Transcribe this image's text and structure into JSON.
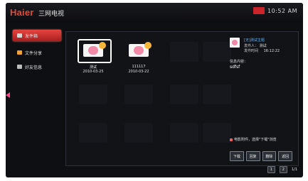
{
  "header": {
    "logo": "Haier",
    "logo_sub": "三网电视",
    "time": "10:52 AM"
  },
  "sidebar": {
    "items": [
      {
        "label": "发件箱",
        "icon": "mail-icon"
      },
      {
        "label": "文件分享",
        "icon": "folder-icon"
      },
      {
        "label": "好友信息",
        "icon": "contacts-icon"
      }
    ]
  },
  "mail_list": [
    {
      "title": "测试",
      "date": "2010-03-25"
    },
    {
      "title": "111117",
      "date": "2010-03-22"
    }
  ],
  "preview": {
    "subject": "[无]测试主题",
    "sender_label": "发件人：",
    "sender": "测试",
    "sent_label": "发件时间",
    "sent_time": "16:12:22",
    "content_label": "信息内容：",
    "content": "sdfsf",
    "hint": "电影附件，选择\"下载\"浏览",
    "buttons": [
      "下载",
      "回复",
      "删除",
      "返回"
    ]
  },
  "bottom": {
    "page_text": "1/1",
    "buttons": [
      "1",
      "2"
    ]
  },
  "colors": {
    "accent": "#e04a3a",
    "active_menu": "#c82b2a",
    "link": "#5db6ff"
  }
}
